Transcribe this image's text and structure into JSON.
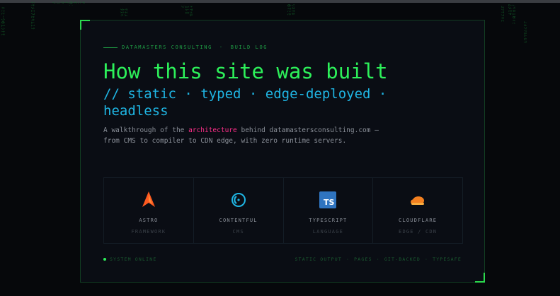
{
  "rain": [
    {
      "text": "ﾊﾐﾋｰｳ01ｼﾅﾓ"
    },
    {
      "text": "ﾃｹﾒｴ7ｶｷﾑﾕﾗ"
    },
    {
      "text": "ﾀﾆﾇ01ｲｸｺｿ"
    },
    {
      "text": "ｾﾈｽﾀﾇﾍ"
    },
    {
      "text": "ﾄﾔﾖﾙ1ﾚﾛﾝ"
    },
    {
      "text": "ﾜｵｻﾎ0ﾏﾐﾓ"
    },
    {
      "text": "ﾖﾂｹﾅﾊﾋ"
    },
    {
      "text": "ﾌﾍﾎ10ﾏﾐﾑﾒﾓﾔ"
    },
    {
      "text": "ﾕﾖﾗﾘﾙﾚﾛﾜ"
    }
  ],
  "header": {
    "brand": "DATAMASTERS CONSULTING",
    "separator": "·",
    "section": "BUILD LOG",
    "title": "How this site was built",
    "subtitle": "// static · typed · edge-deployed · headless"
  },
  "description": {
    "before": "A walkthrough of the ",
    "highlight": "architecture",
    "after": " behind datamastersconsulting.com — from CMS to compiler to CDN edge, with zero runtime servers."
  },
  "stack": [
    {
      "name": "ASTRO",
      "role": "FRAMEWORK",
      "icon": "astro-icon"
    },
    {
      "name": "CONTENTFUL",
      "role": "CMS",
      "icon": "contentful-icon"
    },
    {
      "name": "TYPESCRIPT",
      "role": "LANGUAGE",
      "icon": "typescript-icon",
      "badge": "TS"
    },
    {
      "name": "CLOUDFLARE",
      "role": "EDGE / CDN",
      "icon": "cloudflare-icon"
    }
  ],
  "footer": {
    "status": "SYSTEM ONLINE",
    "tags": [
      "STATIC OUTPUT",
      "PAGES",
      "GIT-BACKED",
      "TYPESAFE"
    ],
    "tag_separator": "·"
  },
  "colors": {
    "accent_green": "#2df05a",
    "accent_blue": "#1fb5e3",
    "highlight_pink": "#ff2f8a",
    "astro_orange": "#ff5a1f",
    "typescript_blue": "#2f74c0",
    "cloudflare_orange": "#f38020"
  }
}
